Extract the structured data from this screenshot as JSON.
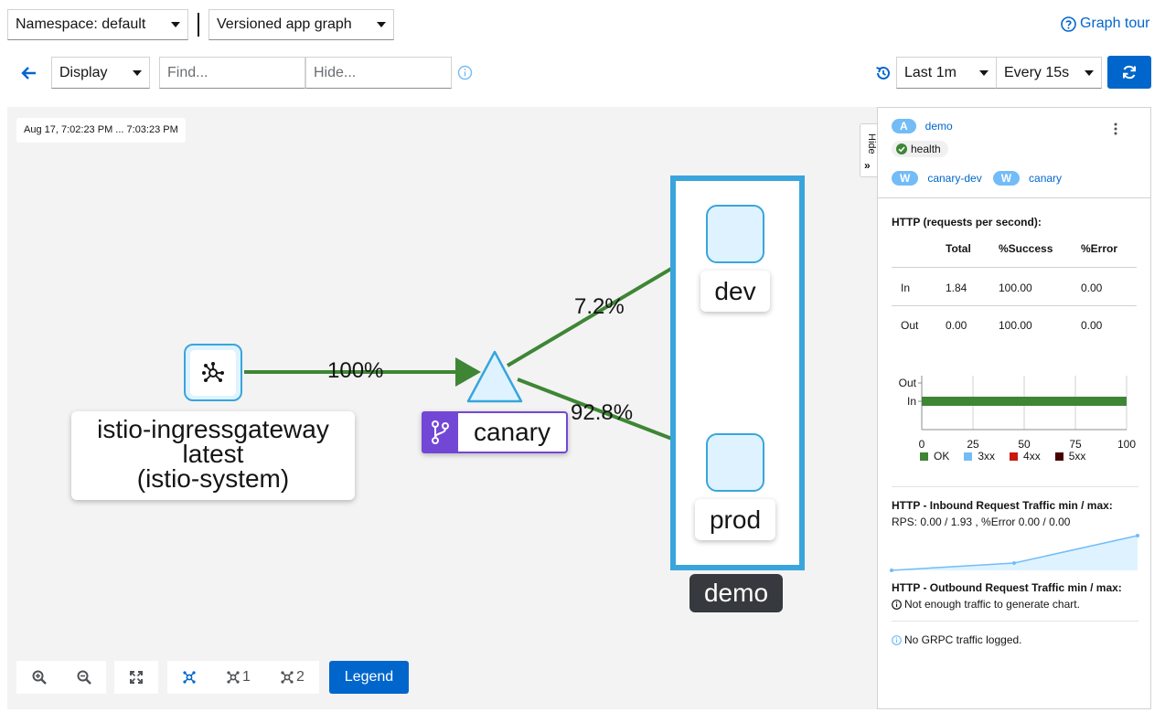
{
  "toolbar": {
    "namespace_label": "Namespace: default",
    "graph_type": "Versioned app graph",
    "graph_tour": "Graph tour",
    "display_label": "Display",
    "find_placeholder": "Find...",
    "hide_placeholder": "Hide...",
    "duration": "Last 1m",
    "refresh_interval": "Every 15s"
  },
  "graph": {
    "timestamp": "Aug 17, 7:02:23 PM ... 7:03:23 PM",
    "nodes": {
      "gateway_line1": "istio-ingressgateway",
      "gateway_line2": "latest",
      "gateway_line3": "(istio-system)",
      "service": "canary",
      "dev": "dev",
      "prod": "prod",
      "box": "demo"
    },
    "edges": {
      "gateway_to_service": "100%",
      "service_to_dev": "7.2%",
      "service_to_prod": "92.8%"
    },
    "edge_color": "#3e8635",
    "node_fill": "#def3ff",
    "node_border": "#39a5dc"
  },
  "zoom_toolbar": {
    "layout1_label": "1",
    "layout2_label": "2",
    "legend_button": "Legend"
  },
  "side_panel": {
    "hide_tab": "Hide",
    "app_badge": "A",
    "app_name": "demo",
    "health_label": "health",
    "workload_badge": "W",
    "workload1": "canary-dev",
    "workload2": "canary",
    "http_title": "HTTP (requests per second):",
    "table_headers": [
      "",
      "Total",
      "%Success",
      "%Error"
    ],
    "table_rows": [
      [
        "In",
        "1.84",
        "100.00",
        "0.00"
      ],
      [
        "Out",
        "0.00",
        "100.00",
        "0.00"
      ]
    ],
    "bar_chart": {
      "categories": [
        "Out",
        "In"
      ],
      "x_ticks": [
        "0",
        "25",
        "50",
        "75",
        "100"
      ],
      "legend": [
        "OK",
        "3xx",
        "4xx",
        "5xx"
      ],
      "colors": [
        "#3e8635",
        "#73bcf7",
        "#c9190b",
        "#470000"
      ],
      "in_ok_percent": 100
    },
    "inbound_title": "HTTP - Inbound Request Traffic min / max:",
    "inbound_stats": "RPS: 0.00 / 1.93 , %Error 0.00 / 0.00",
    "outbound_title": "HTTP - Outbound Request Traffic min / max:",
    "outbound_note": "Not enough traffic to generate chart.",
    "grpc_note": "No GRPC traffic logged."
  },
  "chart_data": {
    "type": "bar",
    "categories": [
      "Out",
      "In"
    ],
    "series": [
      {
        "name": "OK",
        "values": [
          0,
          100
        ]
      },
      {
        "name": "3xx",
        "values": [
          0,
          0
        ]
      },
      {
        "name": "4xx",
        "values": [
          0,
          0
        ]
      },
      {
        "name": "5xx",
        "values": [
          0,
          0
        ]
      }
    ],
    "xlim": [
      0,
      100
    ],
    "orientation": "horizontal",
    "legend_position": "bottom"
  }
}
